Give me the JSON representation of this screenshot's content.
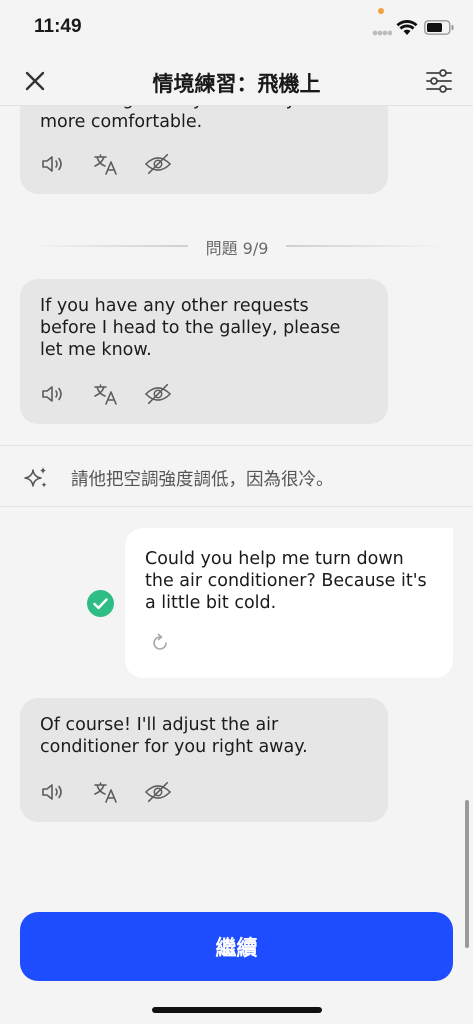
{
  "status_bar": {
    "time": "11:49"
  },
  "header": {
    "title": "情境練習：飛機上"
  },
  "messages": [
    {
      "text": "blanket right away to make you more comfortable."
    },
    {
      "text": "If you have any other requests before I head to the galley, please let me know."
    },
    {
      "text": "Of course! I'll adjust the air conditioner for you right away."
    }
  ],
  "question_divider": {
    "label": "問題 9/9"
  },
  "hint": {
    "text": "請他把空調強度調低，因為很冷。"
  },
  "user_answer": {
    "text": "Could you help me turn down the air conditioner? Because it's a little bit cold."
  },
  "footer": {
    "continue_label": "繼續"
  },
  "colors": {
    "accent": "#1e4cff",
    "success": "#2ebd85",
    "bubble": "#e6e6e6"
  },
  "icons": {
    "speaker": "speaker-icon",
    "translate": "translate-icon",
    "hide": "eye-off-icon",
    "sparkle": "sparkle-icon",
    "retry": "retry-icon",
    "check": "check-icon"
  }
}
